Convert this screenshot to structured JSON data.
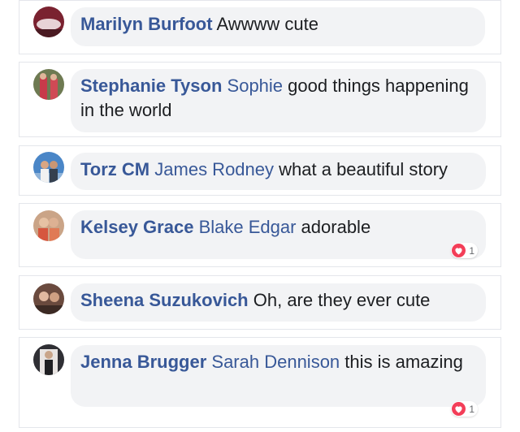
{
  "comments": [
    {
      "name": "Marilyn Burfoot",
      "mention": "",
      "text": "Awwww cute",
      "reactions": "",
      "avatar_bg": "#7a2230",
      "avatar_fg": "#e7d3d6"
    },
    {
      "name": "Stephanie Tyson",
      "mention": "Sophie",
      "text": "good things happening in the world",
      "reactions": "",
      "avatar_bg": "#6e7a52",
      "avatar_fg": "#c83a4a"
    },
    {
      "name": "Torz CM",
      "mention": "James Rodney",
      "text": "what a beautiful story",
      "reactions": "",
      "avatar_bg": "#4a86c7",
      "avatar_fg": "#d8a684"
    },
    {
      "name": "Kelsey Grace",
      "mention": "Blake Edgar",
      "text": "adorable",
      "reactions": "1",
      "avatar_bg": "#caa487",
      "avatar_fg": "#d6573f"
    },
    {
      "name": "Sheena Suzukovich",
      "mention": "",
      "text": "Oh, are they ever cute",
      "reactions": "",
      "avatar_bg": "#6a4a3e",
      "avatar_fg": "#e1b9a0"
    },
    {
      "name": "Jenna Brugger",
      "mention": "Sarah Dennison",
      "text": "this is amazing",
      "reactions": "1",
      "avatar_bg": "#2f2f34",
      "avatar_fg": "#e8e4e2"
    }
  ]
}
